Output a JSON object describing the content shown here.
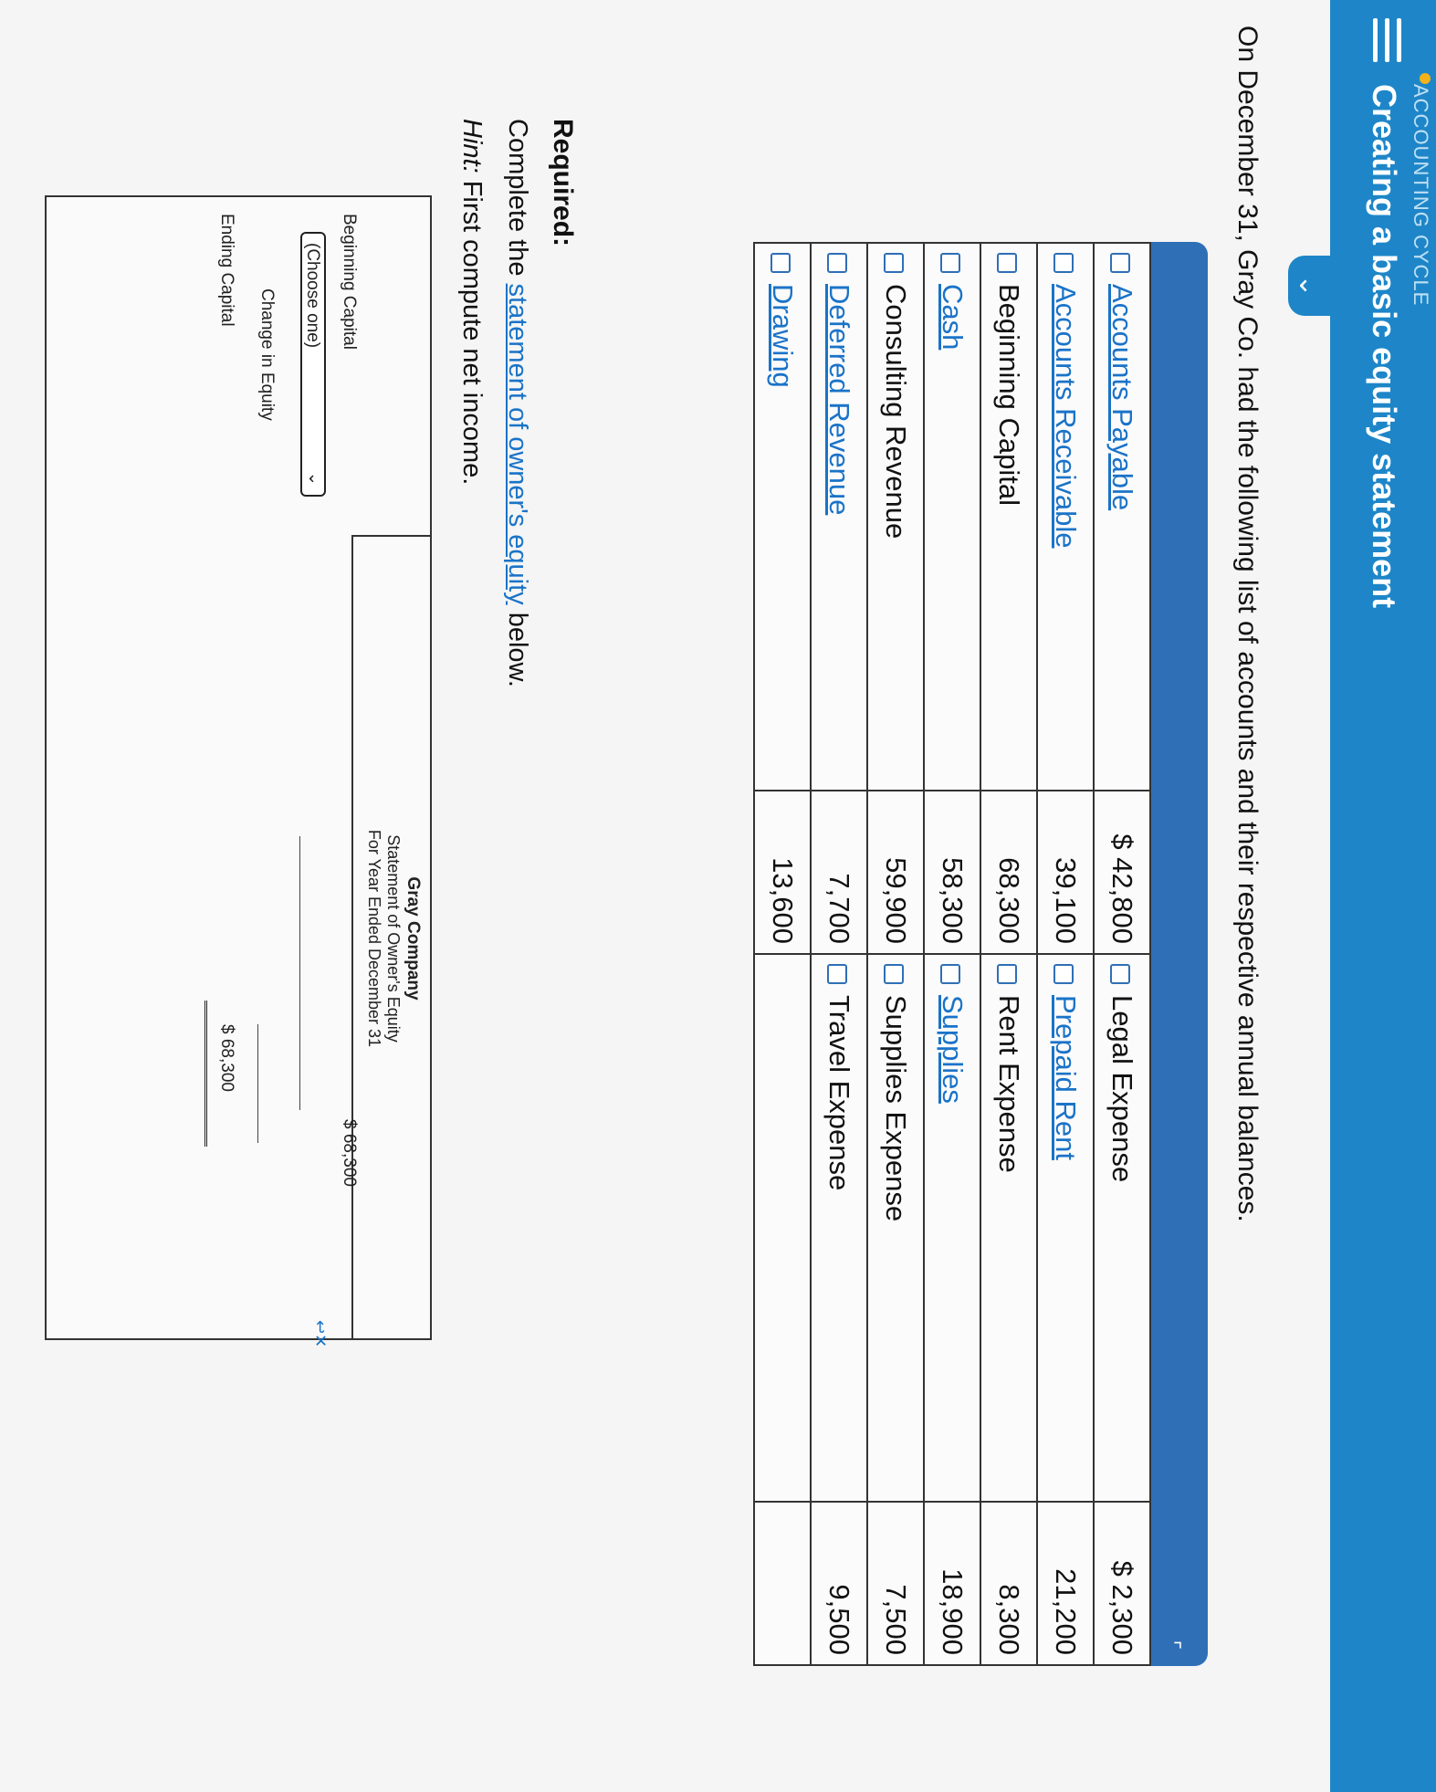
{
  "header": {
    "crumb": "ACCOUNTING CYCLE",
    "title": "Creating a basic equity statement"
  },
  "intro": "On December 31, Gray Co. had the following list of accounts and their respective annual balances.",
  "accounts": [
    {
      "left_name": "Accounts Payable",
      "left_link": true,
      "left_amount": "$ 42,800",
      "right_name": "Legal Expense",
      "right_link": false,
      "right_amount": "$ 2,300"
    },
    {
      "left_name": "Accounts Receivable",
      "left_link": true,
      "left_amount": "39,100",
      "right_name": "Prepaid Rent",
      "right_link": true,
      "right_amount": "21,200"
    },
    {
      "left_name": "Beginning Capital",
      "left_link": false,
      "left_amount": "68,300",
      "right_name": "Rent Expense",
      "right_link": false,
      "right_amount": "8,300"
    },
    {
      "left_name": "Cash",
      "left_link": true,
      "left_amount": "58,300",
      "right_name": "Supplies",
      "right_link": true,
      "right_amount": "18,900"
    },
    {
      "left_name": "Consulting Revenue",
      "left_link": false,
      "left_amount": "59,900",
      "right_name": "Supplies Expense",
      "right_link": false,
      "right_amount": "7,500"
    },
    {
      "left_name": "Deferred Revenue",
      "left_link": true,
      "left_amount": "7,700",
      "right_name": "Travel Expense",
      "right_link": false,
      "right_amount": "9,500"
    },
    {
      "left_name": "Drawing",
      "left_link": true,
      "left_amount": "13,600",
      "right_name": "",
      "right_link": false,
      "right_amount": ""
    }
  ],
  "required": {
    "heading": "Required:",
    "complete_prefix": "Complete the ",
    "complete_link": "statement of owner's equity",
    "complete_suffix": " below.",
    "hint_label": "Hint:",
    "hint_text": " First compute net income."
  },
  "statement": {
    "company": "Gray Company",
    "title": "Statement of Owner's Equity",
    "period": "For Year Ended December 31",
    "beginning_capital_label": "Beginning Capital",
    "beginning_capital_value": "$ 68,300",
    "dropdown_selected": "(Choose one)",
    "change_label": "Change in Equity",
    "ending_label": "Ending Capital",
    "ending_value": "$ 68,300"
  }
}
